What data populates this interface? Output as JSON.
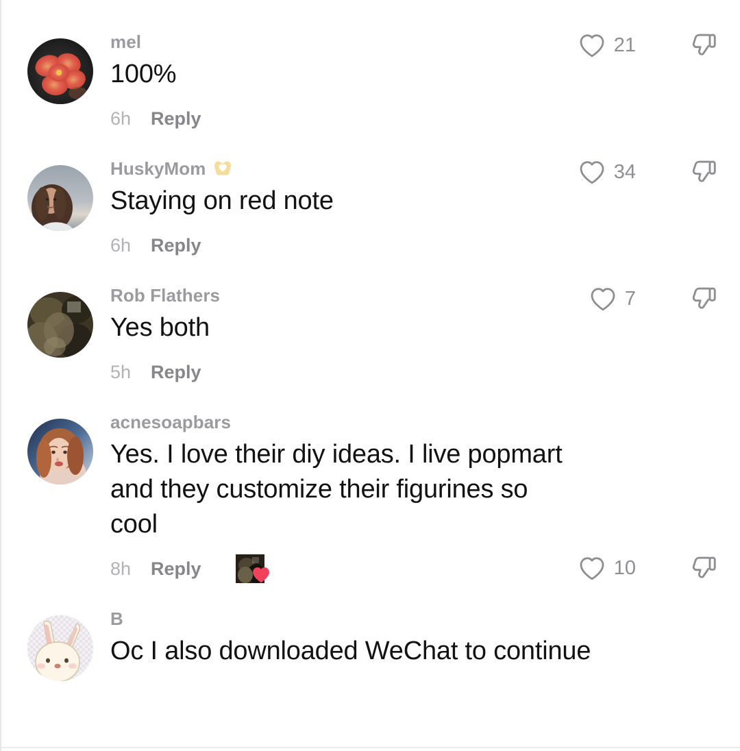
{
  "screen": {
    "app": "comments-panel",
    "accent_heart": "#f2415a",
    "icon_color": "#8e8e93",
    "username_color": "#9b9b9f",
    "text_color": "#121212"
  },
  "labels": {
    "reply": "Reply",
    "like_icon": "heart-outline-icon",
    "dislike_icon": "thumbs-down-outline-icon"
  },
  "comments": [
    {
      "username": "mel",
      "badge_emoji": "",
      "text": "100%",
      "time": "6h",
      "reply": "Reply",
      "likes": "21",
      "avatar": "flower-dark",
      "liked_by": false
    },
    {
      "username": "HuskyMom",
      "badge_emoji": "🫶",
      "text": "Staying on red note",
      "time": "6h",
      "reply": "Reply",
      "likes": "34",
      "avatar": "woman-beach",
      "liked_by": false
    },
    {
      "username": "Rob Flathers",
      "badge_emoji": "",
      "text": "Yes both",
      "time": "5h",
      "reply": "Reply",
      "likes": "7",
      "avatar": "dark-blur",
      "liked_by": false
    },
    {
      "username": "acnesoapbars",
      "badge_emoji": "",
      "text": "Yes. I love their diy ideas. I live popmart and they customize their figurines so cool",
      "time": "8h",
      "reply": "Reply",
      "likes": "10",
      "avatar": "portrait-woman",
      "liked_by": true
    },
    {
      "username": "B",
      "badge_emoji": "",
      "text": "Oc I also downloaded WeChat to continue",
      "time": "",
      "reply": "",
      "likes": "",
      "avatar": "bunny",
      "liked_by": false
    }
  ]
}
